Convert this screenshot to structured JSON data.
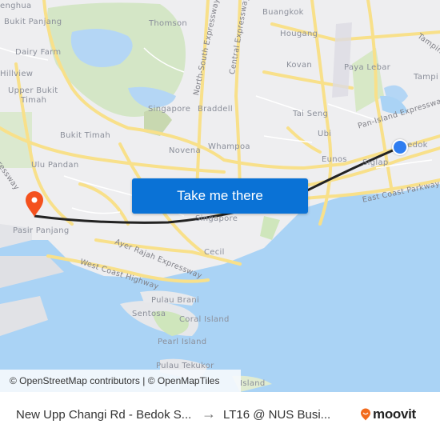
{
  "map": {
    "labels": {
      "tengah": "enghua",
      "bukit_panjang": "Bukit Panjang",
      "dairy_farm": "Dairy Farm",
      "hillview": "Hillview",
      "upper_bukit_timah_1": "Upper Bukit",
      "upper_bukit_timah_2": "Timah",
      "bukit_timah": "Bukit Timah",
      "ulu_pandan": "Ulu Pandan",
      "pasir_panjang": "Pasir Panjang",
      "thomson": "Thomson",
      "singapore_north": "Singapore",
      "braddell": "Braddell",
      "novena": "Novena",
      "whampoa": "Whampoa",
      "buangkok": "Buangkok",
      "hougang": "Hougang",
      "kovan": "Kovan",
      "paya_lebar": "Paya Lebar",
      "tampines": "Tampi",
      "tampines_road": "Tampin",
      "tai_seng": "Tai Seng",
      "ubi": "Ubi",
      "eunos": "Eunos",
      "siglap": "Siglap",
      "bedok": "Bedok",
      "singapore_city": "Singapore",
      "cecil": "Cecil",
      "pulau_brani": "Pulau Brani",
      "sentosa": "Sentosa",
      "coral_island": "Coral Island",
      "pearl_island": "Pearl Island",
      "pulau_tekukor": "Pulau Tekukor",
      "island_s": "Island",
      "pie": "Pan-Island Expressway",
      "ecp": "East Coast Parkway",
      "aye": "Ayer Rajah Expressway",
      "wch": "West Coast Highway",
      "nse": "North-South Expressway",
      "cte": "Central Expressway",
      "bke": "Expressway"
    },
    "origin_marker": {
      "icon": "blue-dot-icon",
      "color": "#2f7df0"
    },
    "destination_marker": {
      "icon": "orange-pin-icon",
      "color": "#f4511e"
    },
    "route_color": "#222222"
  },
  "cta": {
    "label": "Take me there",
    "color": "#0a72d6"
  },
  "attribution": "© OpenStreetMap contributors | © OpenMapTiles",
  "footer": {
    "origin": "New Upp Changi Rd - Bedok S...",
    "arrow": "→",
    "destination": "LT16 @ NUS Busi...",
    "brand": "moovit",
    "brand_color": "#f26b1d"
  }
}
